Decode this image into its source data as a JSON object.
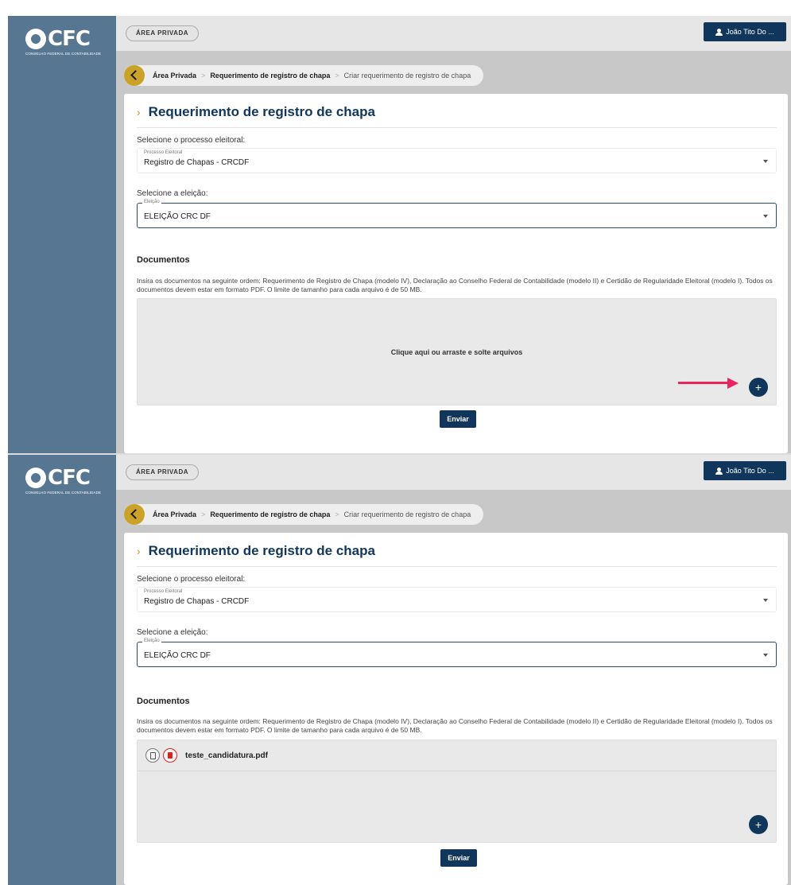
{
  "brand": {
    "name": "CFC",
    "tagline": "CONSELHO FEDERAL DE CONTABILIDADE"
  },
  "header": {
    "area_label": "ÁREA PRIVADA",
    "user_name": "João Tito Do ..."
  },
  "breadcrumb": {
    "items": [
      "Área Privada",
      "Requerimento de registro de chapa",
      "Criar requerimento de registro de chapa"
    ],
    "separator": ">"
  },
  "page": {
    "title": "Requerimento de registro de chapa",
    "process_prompt": "Selecione o processo eleitoral:",
    "process_field_label": "Processo Eleitoral",
    "process_value": "Registro de Chapas - CRCDF",
    "election_prompt": "Selecione a eleição:",
    "election_field_label": "Eleição",
    "election_value": "ELEIÇÃO CRC DF",
    "documents_title": "Documentos",
    "documents_desc": "Insira os documentos na seguinte ordem: Requerimento de Registro de Chapa (modelo IV), Declaração ao Conselho Federal de Contabilidade (modelo II) e Certidão de Regularidade Eleitoral (modelo I). Todos os documentos devem estar em formato PDF. O limite de tamanho para cada arquivo é de 50 MB.",
    "drop_prompt": "Clique aqui ou arraste e solte arquivos",
    "add_symbol": "+",
    "submit_label": "Enviar"
  },
  "uploaded_file": {
    "name": "teste_candidatura.pdf"
  },
  "colors": {
    "sidebar": "#567692",
    "primary": "#10365c",
    "accent": "#c9a227",
    "arrow": "#e8235e",
    "delete": "#dd2222"
  },
  "icons": [
    "user-icon",
    "back-arrow-icon",
    "chevron-right-icon",
    "caret-down-icon",
    "plus-icon",
    "document-icon",
    "trash-icon"
  ]
}
